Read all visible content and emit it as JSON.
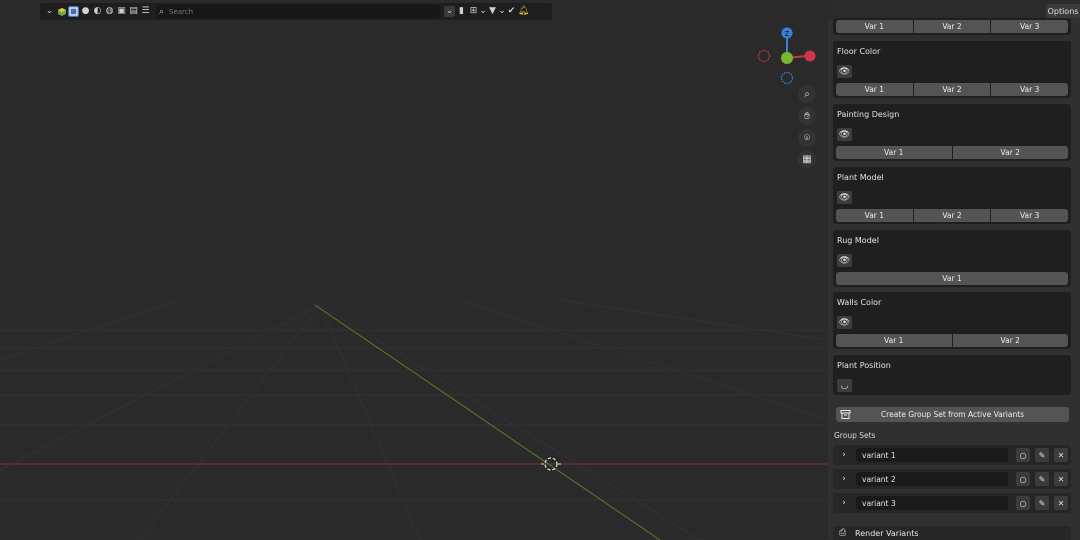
{
  "header": {
    "search_placeholder": "Search",
    "options_label": "Options",
    "icons": [
      "chevron-down-icon",
      "object-cube-icon",
      "select-box-icon",
      "shading-solid-icon",
      "shading-material-icon",
      "shading-render-icon",
      "overlay-icon",
      "view-layers-icon",
      "bookmark-icon",
      "hierarchy-icon",
      "filter-icon",
      "checkmark-shield-icon",
      "bell-icon"
    ]
  },
  "gizmo": {
    "z_label": "Z",
    "axis_colors": {
      "x": "#d0344c",
      "y": "#7ab630",
      "z": "#3a82d6"
    }
  },
  "variant_groups": [
    {
      "title": "",
      "variants": [
        "Var 1",
        "Var 2",
        "Var 3"
      ],
      "partial": true
    },
    {
      "title": "Floor Color",
      "variants": [
        "Var 1",
        "Var 2",
        "Var 3"
      ]
    },
    {
      "title": "Painting Design",
      "variants": [
        "Var 1",
        "Var 2"
      ]
    },
    {
      "title": "Plant Model",
      "variants": [
        "Var 1",
        "Var 2",
        "Var 3"
      ]
    },
    {
      "title": "Rug Model",
      "variants": [
        "Var 1"
      ]
    },
    {
      "title": "Walls Color",
      "variants": [
        "Var 1",
        "Var 2"
      ]
    },
    {
      "title": "Plant Position",
      "variants": []
    }
  ],
  "create_group_set": {
    "label": "Create Group Set from Active Variants"
  },
  "group_sets": {
    "title": "Group Sets",
    "items": [
      {
        "name": "variant 1"
      },
      {
        "name": "variant 2"
      },
      {
        "name": "variant 3"
      }
    ]
  },
  "render": {
    "label": "Render Variants"
  },
  "colors": {
    "accent": "#4772b3",
    "grid_x_axis": "#8a3a3a",
    "grid_y_axis": "#6f8a2e"
  }
}
